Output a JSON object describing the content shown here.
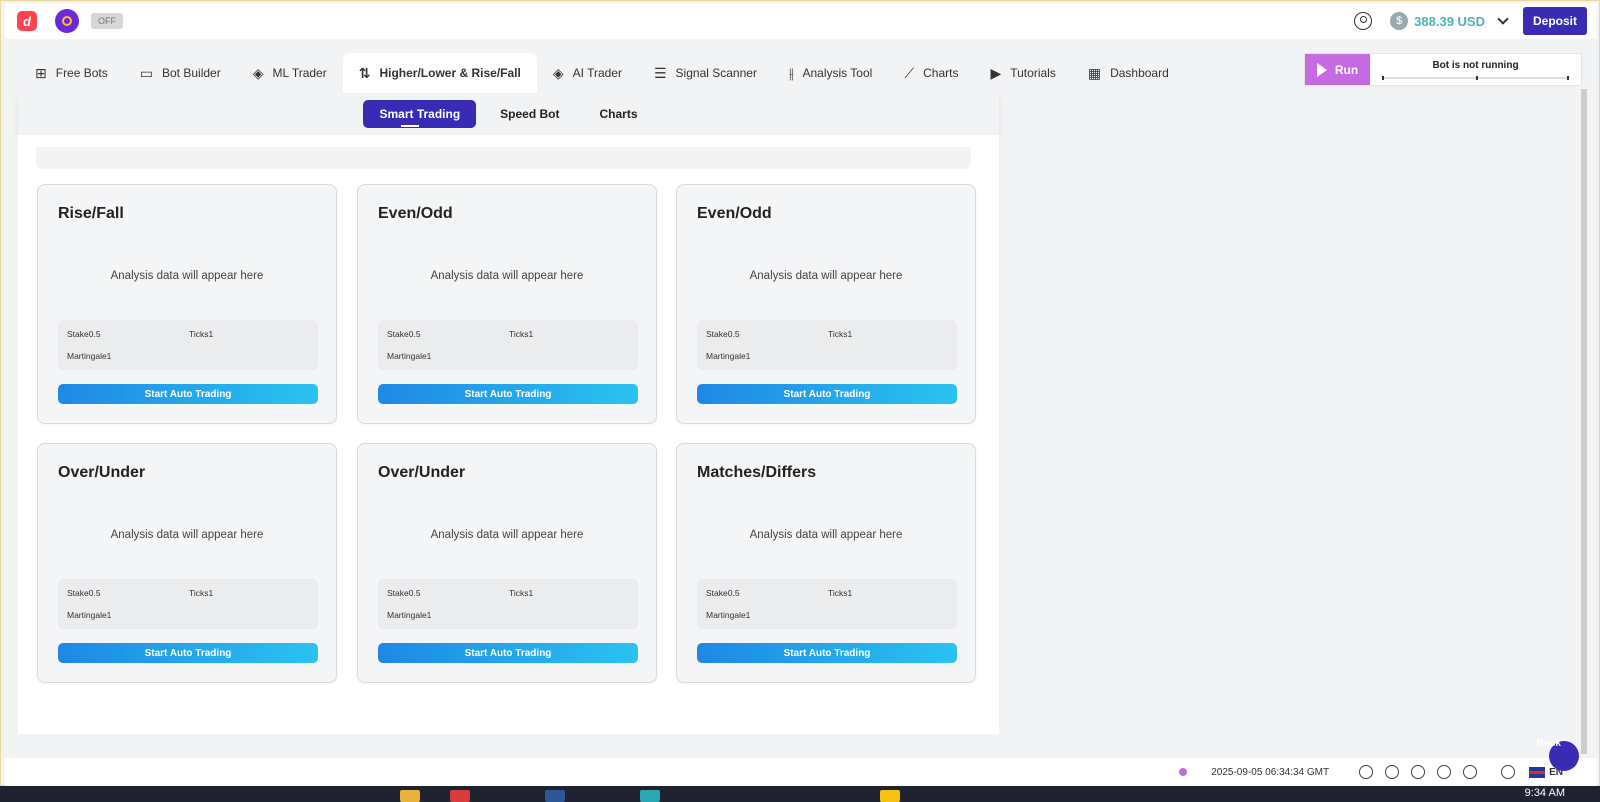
{
  "header": {
    "toggle_label": "OFF",
    "balance": "388.39 USD",
    "deposit_label": "Deposit"
  },
  "tabs": [
    {
      "label": "Free Bots",
      "icon": "grid-plus-icon"
    },
    {
      "label": "Bot Builder",
      "icon": "builder-icon"
    },
    {
      "label": "ML Trader",
      "icon": "layers-bot-icon"
    },
    {
      "label": "Higher/Lower & Rise/Fall",
      "icon": "arrows-updown-icon",
      "active": true
    },
    {
      "label": "AI Trader",
      "icon": "layers-icon"
    },
    {
      "label": "Signal Scanner",
      "icon": "list-icon"
    },
    {
      "label": "Analysis Tool",
      "icon": "sliders-icon"
    },
    {
      "label": "Charts",
      "icon": "line-chart-icon"
    },
    {
      "label": "Tutorials",
      "icon": "play-icon"
    },
    {
      "label": "Dashboard",
      "icon": "dashboard-icon"
    }
  ],
  "run_panel": {
    "run_label": "Run",
    "status": "Bot is not running"
  },
  "subtabs": [
    "Smart Trading",
    "Speed Bot",
    "Charts"
  ],
  "cards": [
    {
      "title": "Rise/Fall",
      "placeholder": "Analysis data will appear here",
      "stake": "Stake0.5",
      "ticks": "Ticks1",
      "martingale": "Martingale1",
      "button": "Start Auto Trading"
    },
    {
      "title": "Even/Odd",
      "placeholder": "Analysis data will appear here",
      "stake": "Stake0.5",
      "ticks": "Ticks1",
      "martingale": "Martingale1",
      "button": "Start Auto Trading"
    },
    {
      "title": "Even/Odd",
      "placeholder": "Analysis data will appear here",
      "stake": "Stake0.5",
      "ticks": "Ticks1",
      "martingale": "Martingale1",
      "button": "Start Auto Trading"
    },
    {
      "title": "Over/Under",
      "placeholder": "Analysis data will appear here",
      "stake": "Stake0.5",
      "ticks": "Ticks1",
      "martingale": "Martingale1",
      "button": "Start Auto Trading"
    },
    {
      "title": "Over/Under",
      "placeholder": "Analysis data will appear here",
      "stake": "Stake0.5",
      "ticks": "Ticks1",
      "martingale": "Martingale1",
      "button": "Start Auto Trading"
    },
    {
      "title": "Matches/Differs",
      "placeholder": "Analysis data will appear here",
      "stake": "Stake0.5",
      "ticks": "Ticks1",
      "martingale": "Martingale1",
      "button": "Start Auto Trading"
    }
  ],
  "footer": {
    "timestamp": "2025-09-05 06:34:34 GMT",
    "language": "EN",
    "back_label": "Back"
  },
  "taskbar": {
    "time": "9:34 AM"
  },
  "colors": {
    "brand_purple": "#3a2bb5",
    "run_purple": "#c56ae0",
    "balance_teal": "#4bb4b3"
  }
}
